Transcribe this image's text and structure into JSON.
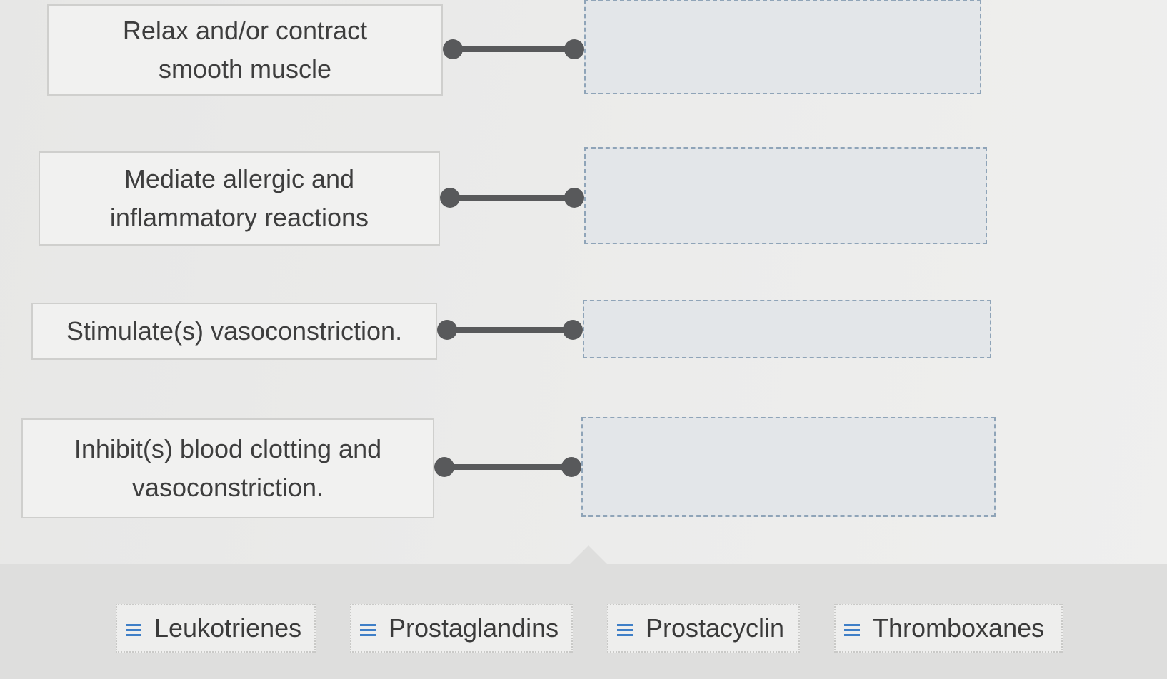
{
  "prompts": [
    {
      "line1": "Relax and/or contract",
      "line2": "smooth muscle"
    },
    {
      "line1": "Mediate allergic and",
      "line2": "inflammatory reactions"
    },
    {
      "line1": "Stimulate(s) vasoconstriction.",
      "line2": ""
    },
    {
      "line1": "Inhibit(s) blood clotting and",
      "line2": "vasoconstriction."
    }
  ],
  "answer_chips": [
    {
      "label": "Leukotrienes",
      "icon": "drag-handle-icon"
    },
    {
      "label": "Prostaglandins",
      "icon": "drag-handle-icon"
    },
    {
      "label": "Prostacyclin",
      "icon": "drag-handle-icon"
    },
    {
      "label": "Thromboxanes",
      "icon": "drag-handle-icon"
    }
  ],
  "colors": {
    "connector": "#58595b",
    "drag_handle": "#3f7fc7",
    "dropzone_border": "#8fa4b8",
    "dropzone_fill": "#e3e6e9"
  }
}
